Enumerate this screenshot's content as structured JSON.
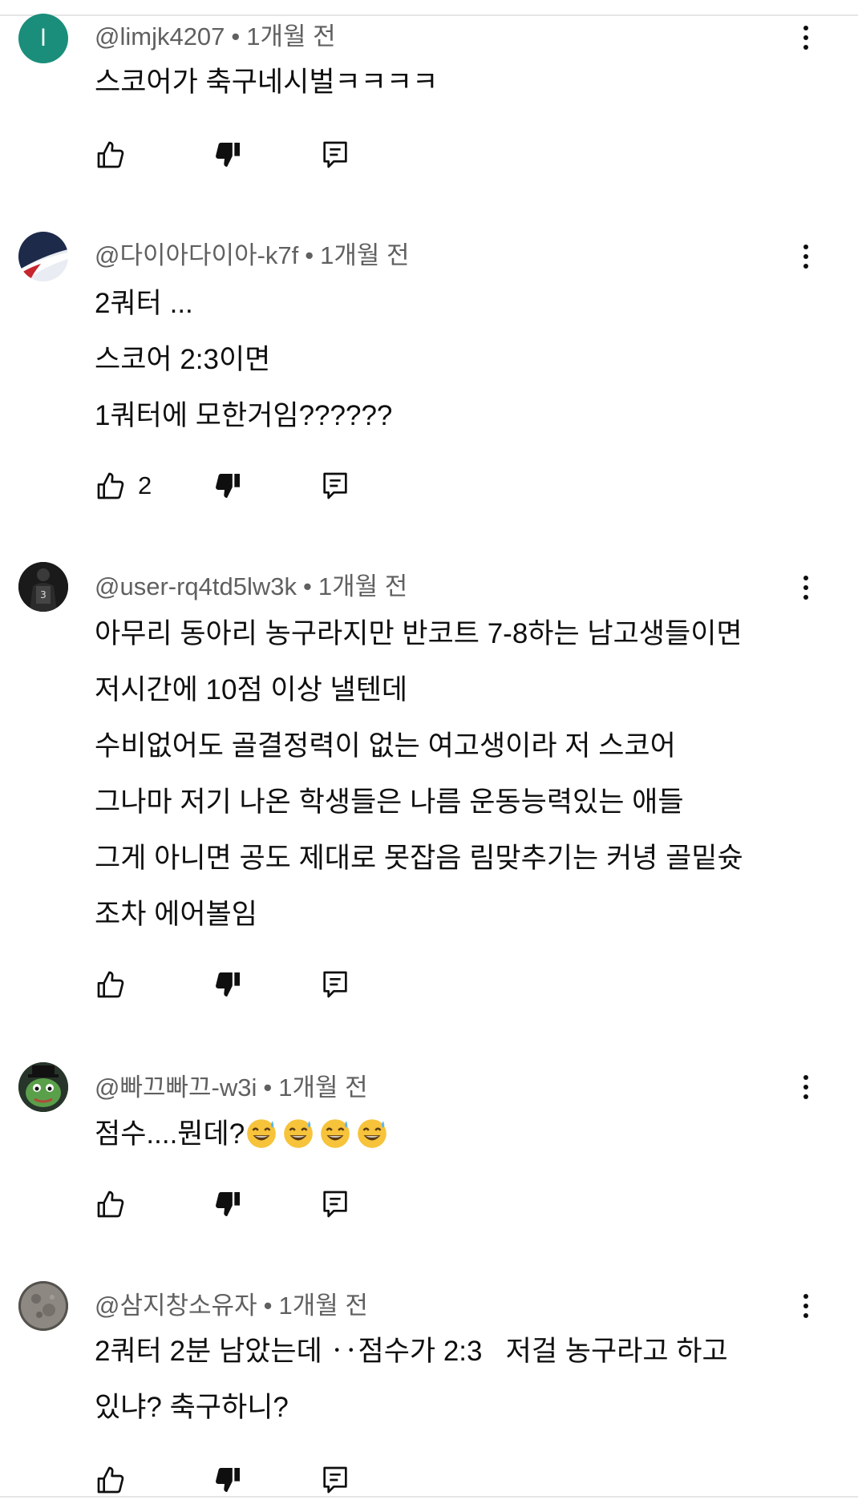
{
  "comments": [
    {
      "handle": "@limjk4207",
      "time": "1개월 전",
      "avatar_letter": "l",
      "avatar_color": "#1a8e7a",
      "lines": [
        "스코어가 축구네시벌ㅋㅋㅋㅋ"
      ],
      "likes": ""
    },
    {
      "handle": "@다이아다이아-k7f",
      "time": "1개월 전",
      "lines": [
        "2쿼터 ...",
        "스코어 2:3이면",
        "1쿼터에 모한거임??????"
      ],
      "likes": "2"
    },
    {
      "handle": "@user-rq4td5lw3k",
      "time": "1개월 전",
      "lines": [
        "아무리 동아리 농구라지만 반코트 7-8하는 남고생들이면",
        "저시간에 10점 이상 낼텐데",
        "수비없어도 골결정력이 없는 여고생이라 저 스코어",
        "그나마 저기 나온 학생들은 나름 운동능력있는 애들",
        "그게 아니면 공도 제대로 못잡음 림맞추기는 커녕 골밑슛",
        "조차 에어볼임"
      ],
      "likes": ""
    },
    {
      "handle": "@빠끄빠끄-w3i",
      "time": "1개월 전",
      "lines": [
        "점수....뭔데?"
      ],
      "likes": ""
    },
    {
      "handle": "@삼지창소유자",
      "time": "1개월 전",
      "lines": [
        "2쿼터 2분 남았는데 ‥점수가 2:3   저걸 농구라고 하고",
        "있냐? 축구하니?"
      ],
      "likes": ""
    }
  ],
  "separator": "•",
  "icons": {
    "like": "thumbs-up-icon",
    "dislike": "thumbs-down-icon",
    "reply": "reply-comment-icon",
    "menu": "more-vertical-icon"
  }
}
